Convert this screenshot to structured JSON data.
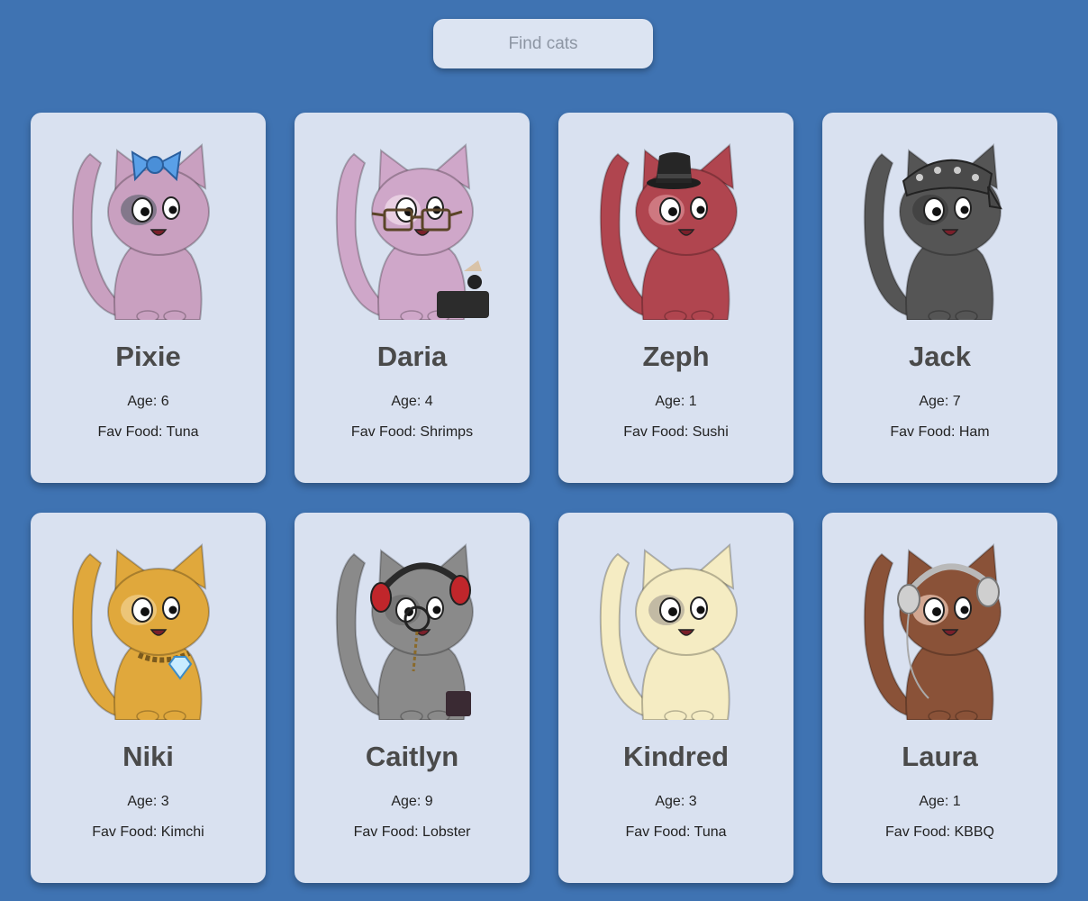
{
  "search": {
    "placeholder": "Find cats"
  },
  "colors": {
    "background": "#3f73b2",
    "card": "#d9e1f0",
    "name_text": "#4a4a4a"
  },
  "labels": {
    "age_prefix": "Age: ",
    "food_prefix": "Fav Food: "
  },
  "cats": [
    {
      "name": "Pixie",
      "age": "6",
      "fav_food": "Tuna",
      "fur": "#c9a0c0",
      "accent": "#6b6b7a",
      "accessory": "blue-bow",
      "icon": "pixie-cat-icon"
    },
    {
      "name": "Daria",
      "age": "4",
      "fav_food": "Shrimps",
      "fur": "#cfa7c9",
      "accent": "#f0dce9",
      "accessory": "glasses",
      "icon": "daria-cat-icon"
    },
    {
      "name": "Zeph",
      "age": "1",
      "fav_food": "Sushi",
      "fur": "#b0454f",
      "accent": "#d88a90",
      "accessory": "black-hat",
      "icon": "zeph-cat-icon"
    },
    {
      "name": "Jack",
      "age": "7",
      "fav_food": "Ham",
      "fur": "#555555",
      "accent": "#3e3e3e",
      "accessory": "bandana",
      "icon": "jack-cat-icon"
    },
    {
      "name": "Niki",
      "age": "3",
      "fav_food": "Kimchi",
      "fur": "#e0a83c",
      "accent": "#f0cf8c",
      "accessory": "diamond-collar",
      "icon": "niki-cat-icon"
    },
    {
      "name": "Caitlyn",
      "age": "9",
      "fav_food": "Lobster",
      "fur": "#8a8a8a",
      "accent": "#6f6f6f",
      "accessory": "red-headphones",
      "icon": "caitlyn-cat-icon"
    },
    {
      "name": "Kindred",
      "age": "3",
      "fav_food": "Tuna",
      "fur": "#f5ecc3",
      "accent": "#b0a99a",
      "accessory": "none",
      "icon": "kindred-cat-icon"
    },
    {
      "name": "Laura",
      "age": "1",
      "fav_food": "KBBQ",
      "fur": "#8a5238",
      "accent": "#e9c4b0",
      "accessory": "silver-headphones",
      "icon": "laura-cat-icon"
    }
  ]
}
